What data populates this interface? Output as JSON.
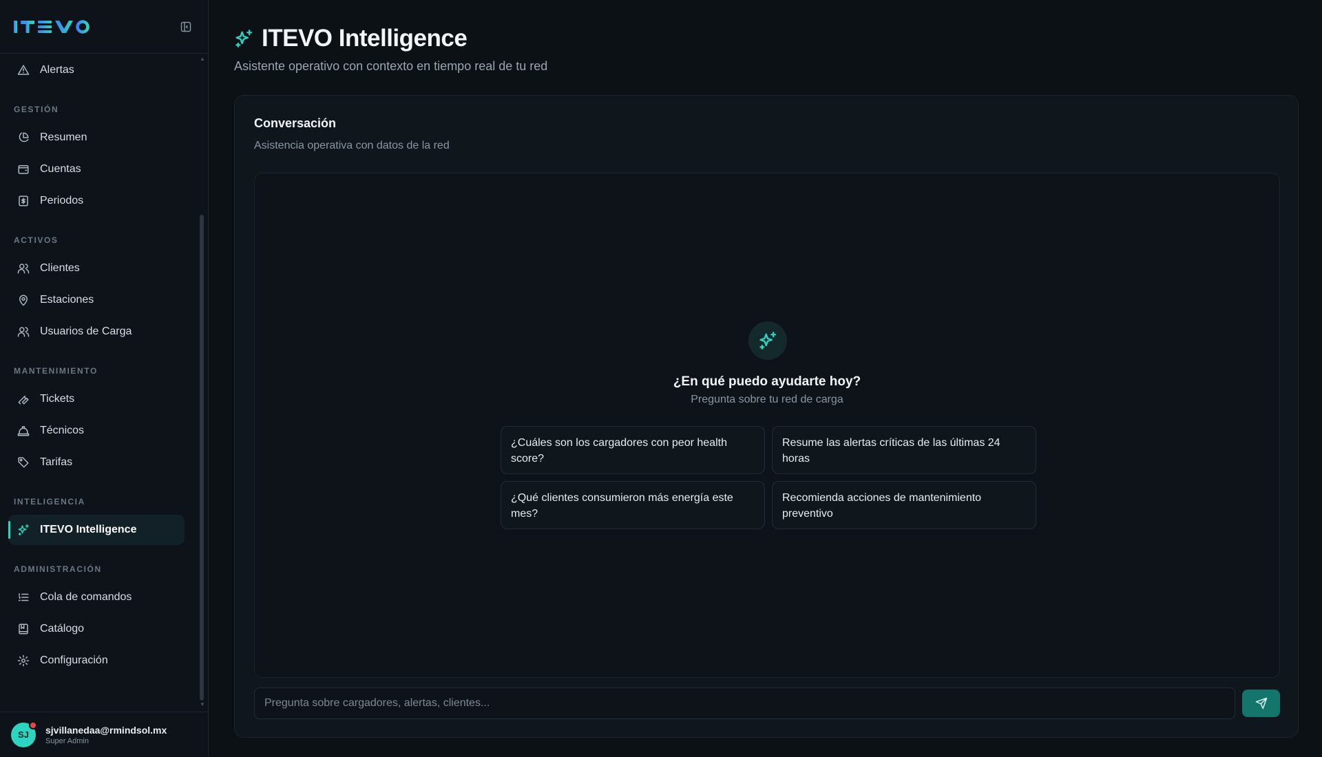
{
  "brand": {
    "logo_text": "ITEVO",
    "colors": {
      "logo_gradient_start": "#3b82f6",
      "logo_gradient_end": "#2dd4bf",
      "accent": "#2dd4bf"
    }
  },
  "sidebar": {
    "top_items": [
      {
        "label": "Alertas",
        "icon": "alert-triangle-icon"
      }
    ],
    "sections": [
      {
        "label": "GESTIÓN",
        "items": [
          {
            "label": "Resumen",
            "icon": "pie-chart-icon"
          },
          {
            "label": "Cuentas",
            "icon": "wallet-icon"
          },
          {
            "label": "Periodos",
            "icon": "receipt-icon"
          }
        ]
      },
      {
        "label": "ACTIVOS",
        "items": [
          {
            "label": "Clientes",
            "icon": "users-icon"
          },
          {
            "label": "Estaciones",
            "icon": "map-pin-icon"
          },
          {
            "label": "Usuarios de Carga",
            "icon": "users-icon"
          }
        ]
      },
      {
        "label": "MANTENIMIENTO",
        "items": [
          {
            "label": "Tickets",
            "icon": "wrench-icon"
          },
          {
            "label": "Técnicos",
            "icon": "hard-hat-icon"
          },
          {
            "label": "Tarifas",
            "icon": "tag-icon"
          }
        ]
      },
      {
        "label": "INTELIGENCIA",
        "items": [
          {
            "label": "ITEVO Intelligence",
            "icon": "sparkles-icon",
            "active": true
          }
        ]
      },
      {
        "label": "ADMINISTRACIÓN",
        "items": [
          {
            "label": "Cola de comandos",
            "icon": "list-icon"
          },
          {
            "label": "Catálogo",
            "icon": "book-icon"
          },
          {
            "label": "Configuración",
            "icon": "gear-icon"
          }
        ]
      }
    ],
    "user": {
      "initials": "SJ",
      "email": "sjvillanedaa@rmindsol.mx",
      "role": "Super Admin"
    }
  },
  "header": {
    "title": "ITEVO Intelligence",
    "subtitle": "Asistente operativo con contexto en tiempo real de tu red"
  },
  "conversation": {
    "title": "Conversación",
    "subtitle": "Asistencia operativa con datos de la red",
    "empty_title": "¿En qué puedo ayudarte hoy?",
    "empty_subtitle": "Pregunta sobre tu red de carga",
    "suggestions": [
      "¿Cuáles son los cargadores con peor health score?",
      "Resume las alertas críticas de las últimas 24 horas",
      "¿Qué clientes consumieron más energía este mes?",
      "Recomienda acciones de mantenimiento preventivo"
    ],
    "input_placeholder": "Pregunta sobre cargadores, alertas, clientes..."
  }
}
